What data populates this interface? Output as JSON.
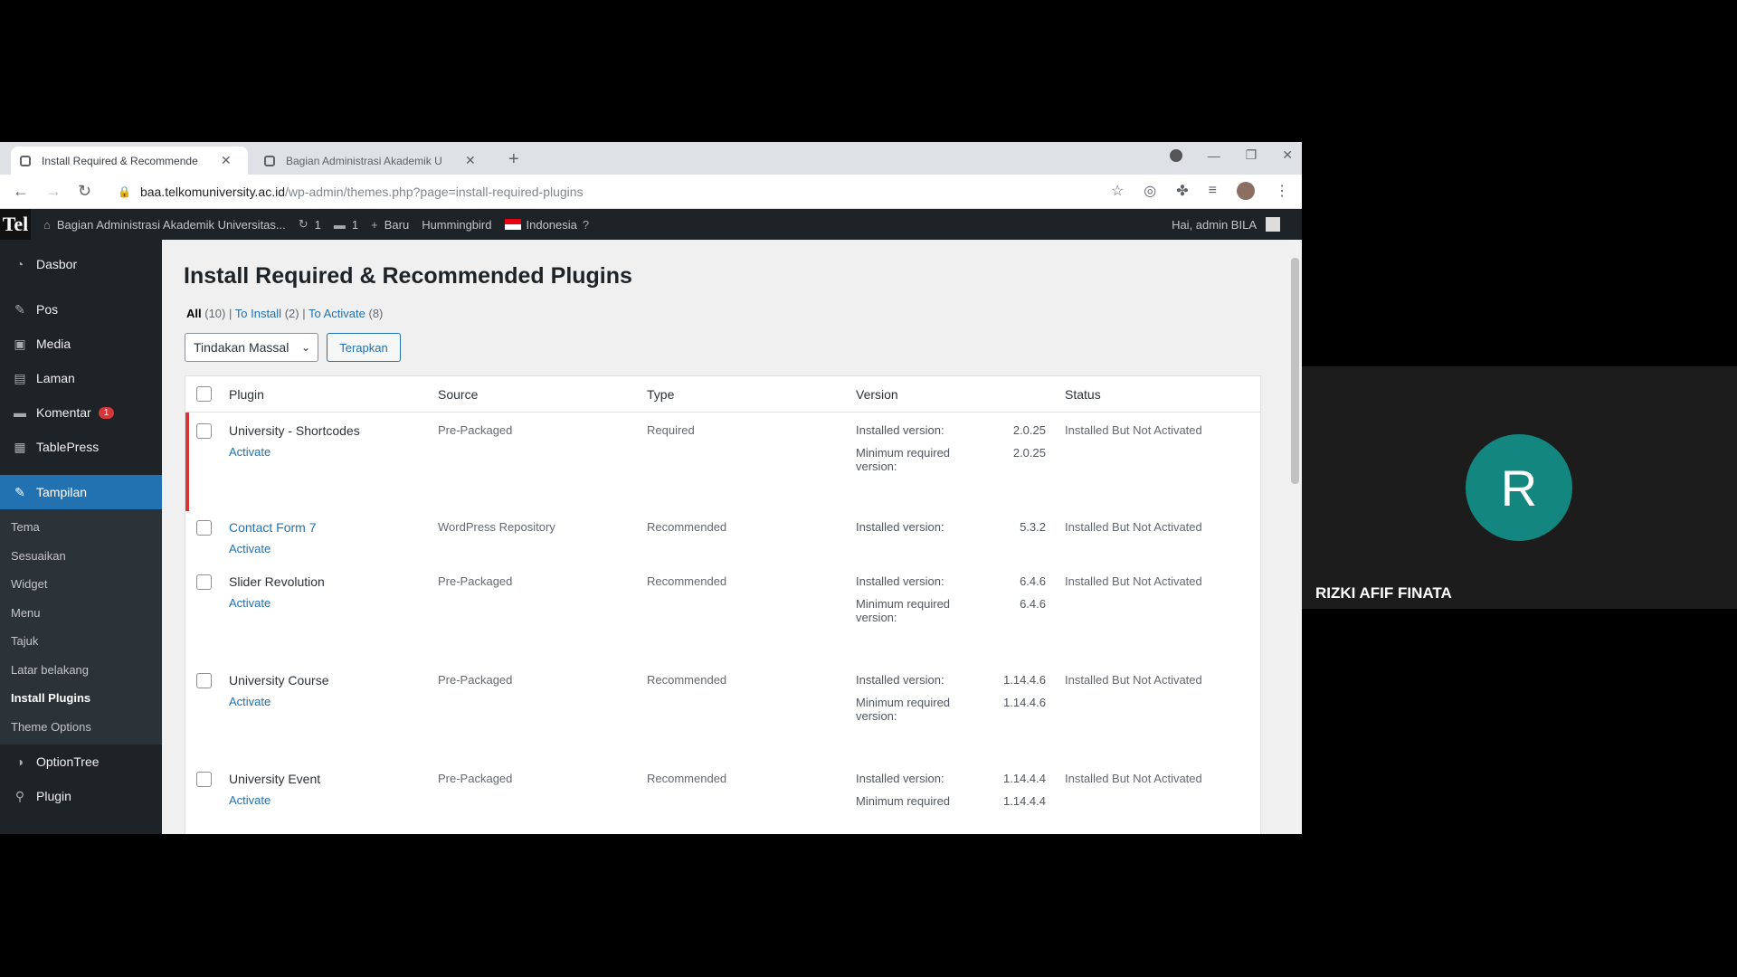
{
  "browser": {
    "tabs": [
      {
        "label": "Install Required & Recommende",
        "active": true
      },
      {
        "label": "Bagian Administrasi Akademik U",
        "active": false
      }
    ],
    "new_tab": "+",
    "url_host": "baa.telkomuniversity.ac.id",
    "url_path": "/wp-admin/themes.php?page=install-required-plugins"
  },
  "adminbar": {
    "logo": "Tel",
    "site_name": "Bagian Administrasi Akademik Universitas...",
    "updates_count": "1",
    "comments_count": "1",
    "new_label": "Baru",
    "hummingbird_label": "Hummingbird",
    "language_label": "Indonesia",
    "greeting": "Hai, admin BILA"
  },
  "sidebar": {
    "items": [
      {
        "label": "Dasbor",
        "icon": "dashboard-icon"
      },
      {
        "label": "Pos",
        "icon": "pin-icon"
      },
      {
        "label": "Media",
        "icon": "media-icon"
      },
      {
        "label": "Laman",
        "icon": "page-icon"
      },
      {
        "label": "Komentar",
        "icon": "comment-icon",
        "badge": "1"
      },
      {
        "label": "TablePress",
        "icon": "table-icon"
      },
      {
        "label": "Tampilan",
        "icon": "brush-icon",
        "current": true
      }
    ],
    "submenu": [
      "Tema",
      "Sesuaikan",
      "Widget",
      "Menu",
      "Tajuk",
      "Latar belakang",
      "Install Plugins",
      "Theme Options"
    ],
    "submenu_current": "Install Plugins",
    "after": [
      {
        "label": "OptionTree",
        "icon": "option-icon"
      },
      {
        "label": "Plugin",
        "icon": "plugin-icon"
      }
    ]
  },
  "main": {
    "title": "Install Required & Recommended Plugins",
    "filters": {
      "all": "All",
      "all_count": "(10)",
      "to_install": "To Install",
      "to_install_count": "(2)",
      "to_activate": "To Activate",
      "to_activate_count": "(8)"
    },
    "bulk_action": "Tindakan Massal",
    "apply": "Terapkan",
    "columns": [
      "Plugin",
      "Source",
      "Type",
      "Version",
      "Status"
    ],
    "rows": [
      {
        "plugin": "University - Shortcodes",
        "action": "Activate",
        "source": "Pre-Packaged",
        "type": "Required",
        "installed_label": "Installed version:",
        "installed": "2.0.25",
        "min_label": "Minimum required version:",
        "min": "2.0.25",
        "status": "Installed But Not Activated",
        "required": true,
        "link": false
      },
      {
        "plugin": "Contact Form 7",
        "action": "Activate",
        "source": "WordPress Repository",
        "type": "Recommended",
        "installed_label": "Installed version:",
        "installed": "5.3.2",
        "status": "Installed But Not Activated",
        "required": false,
        "link": true
      },
      {
        "plugin": "Slider Revolution",
        "action": "Activate",
        "source": "Pre-Packaged",
        "type": "Recommended",
        "installed_label": "Installed version:",
        "installed": "6.4.6",
        "min_label": "Minimum required version:",
        "min": "6.4.6",
        "status": "Installed But Not Activated",
        "required": false,
        "link": false
      },
      {
        "plugin": "University Course",
        "action": "Activate",
        "source": "Pre-Packaged",
        "type": "Recommended",
        "installed_label": "Installed version:",
        "installed": "1.14.4.6",
        "min_label": "Minimum required version:",
        "min": "1.14.4.6",
        "status": "Installed But Not Activated",
        "required": false,
        "link": false
      },
      {
        "plugin": "University Event",
        "action": "Activate",
        "source": "Pre-Packaged",
        "type": "Recommended",
        "installed_label": "Installed version:",
        "installed": "1.14.4.4",
        "min_label": "Minimum required",
        "min": "1.14.4.4",
        "status": "Installed But Not Activated",
        "required": false,
        "link": false
      }
    ]
  },
  "meeting": {
    "avatar_letter": "R",
    "avatar_color": "#13877f",
    "participant_name": "RIZKI AFIF FINATA"
  }
}
